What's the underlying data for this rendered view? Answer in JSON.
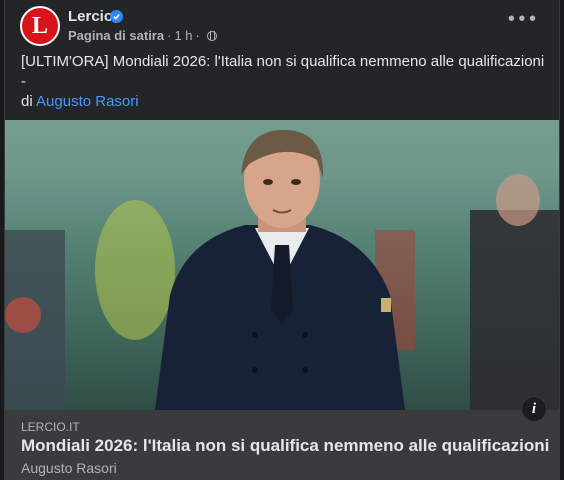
{
  "post": {
    "page_name": "Lercio",
    "avatar_letter": "L",
    "category": "Pagina di satira",
    "time": "1 h",
    "separator": "·",
    "text_line1": "[ULTIM'ORA] Mondiali 2026: l'Italia non si qualifica nemmeno alle qualificazioni",
    "text_line2": "-",
    "by_prefix": "di",
    "author_link": "Augusto Rasori"
  },
  "link_preview": {
    "domain": "LERCIO.IT",
    "title": "Mondiali 2026: l'Italia non si qualifica nemmeno alle qualificazioni",
    "author": "Augusto Rasori",
    "info_icon": "i"
  },
  "colors": {
    "brand": "#d7141a",
    "link": "#4599ff",
    "verified": "#2d88ff",
    "card_bg": "#242526",
    "preview_bg": "#3a3b3c"
  }
}
